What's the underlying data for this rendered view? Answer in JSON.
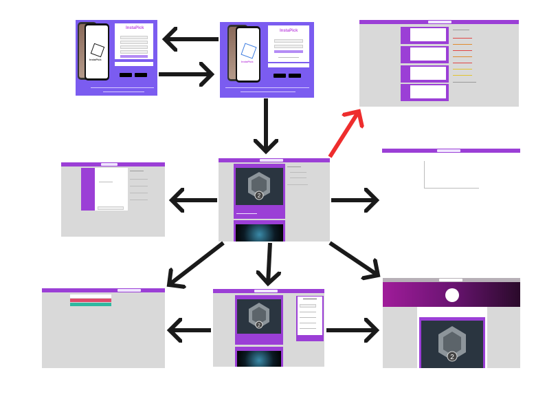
{
  "login_screen_1": {
    "brand": "InstaPick",
    "brand_in_phone": "InstaPick"
  },
  "login_screen_2": {
    "brand": "InstaPick",
    "brand_in_phone": "InstaPick"
  },
  "profile_badge": {
    "level": "2"
  },
  "colors": {
    "arrow_default": "#1a1a1a",
    "arrow_highlight": "#ee2d2d",
    "brand_purple": "#9b3fd6",
    "login_background": "#7b5cf0",
    "page_gray": "#d9d9d9"
  }
}
